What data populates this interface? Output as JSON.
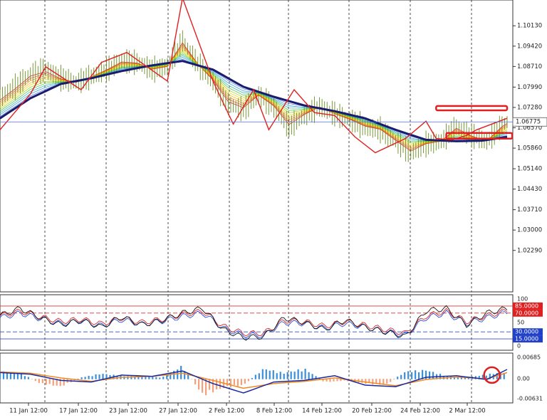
{
  "chart_data": [
    {
      "type": "line",
      "pane": "price",
      "ylim": [
        1.0129,
        1.1103
      ],
      "y_ticks": [
        "1.10130",
        "1.09420",
        "1.08710",
        "1.07990",
        "1.07280",
        "1.06570",
        "1.05860",
        "1.05140",
        "1.04430",
        "1.03710",
        "1.03000",
        "1.02290"
      ],
      "x_ticks": [
        "11 Jan 12:00",
        "17 Jan 12:00",
        "23 Jan 12:00",
        "27 Jan 12:00",
        "2 Feb 12:00",
        "8 Feb 12:00",
        "14 Feb 12:00",
        "20 Feb 12:00",
        "24 Feb 12:00",
        "2 Mar 12:00"
      ],
      "current_price": "1.06775",
      "x_index_range": [
        0,
        100
      ],
      "colors": {
        "price_bar": "#6b8e23",
        "main_ma": "#1a1a6e",
        "zigzag": "#e02020",
        "hline": "#4f6fd8",
        "grid": "#222222"
      },
      "series": [
        {
          "role": "close",
          "x": [
            0,
            3,
            6,
            9,
            12,
            15,
            18,
            21,
            24,
            27,
            30,
            33,
            36,
            39,
            42,
            45,
            48,
            51,
            54,
            57,
            60,
            63,
            66,
            69,
            72,
            75,
            78,
            81,
            84,
            87,
            90,
            93,
            96,
            99,
            100
          ],
          "values": [
            1.076,
            1.08,
            1.0845,
            1.086,
            1.083,
            1.0815,
            1.0835,
            1.086,
            1.089,
            1.0885,
            1.086,
            1.087,
            1.096,
            1.088,
            1.082,
            1.074,
            1.072,
            1.077,
            1.073,
            1.066,
            1.07,
            1.073,
            1.0705,
            1.0685,
            1.066,
            1.065,
            1.061,
            1.057,
            1.06,
            1.061,
            1.066,
            1.063,
            1.061,
            1.0665,
            1.0677
          ]
        },
        {
          "role": "main-ma",
          "x": [
            0,
            6,
            12,
            18,
            24,
            30,
            36,
            42,
            48,
            54,
            60,
            66,
            72,
            78,
            84,
            90,
            95,
            100
          ],
          "values": [
            1.069,
            1.076,
            1.081,
            1.083,
            1.0855,
            1.0875,
            1.089,
            1.086,
            1.08,
            1.0765,
            1.0735,
            1.0715,
            1.069,
            1.065,
            1.0615,
            1.061,
            1.0612,
            1.0625
          ]
        },
        {
          "role": "zigzag",
          "x": [
            0,
            6,
            9,
            16,
            20,
            25,
            29,
            33,
            36,
            42,
            46,
            50,
            53,
            58,
            62,
            66,
            70,
            74,
            80,
            84,
            86,
            89,
            92,
            94,
            100
          ],
          "values": [
            1.065,
            1.0775,
            1.087,
            1.079,
            1.0885,
            1.092,
            1.087,
            1.082,
            1.111,
            1.082,
            1.067,
            1.079,
            1.065,
            1.079,
            1.071,
            1.07,
            1.0625,
            1.057,
            1.062,
            1.068,
            1.062,
            1.0615,
            1.063,
            1.065,
            1.069
          ]
        }
      ],
      "annotations": [
        {
          "type": "rect",
          "x": [
            86,
            100
          ],
          "y": [
            1.0718,
            1.0733
          ]
        },
        {
          "type": "rect",
          "x": [
            88,
            101
          ],
          "y": [
            1.0619,
            1.0639
          ]
        }
      ]
    },
    {
      "type": "line",
      "pane": "stochastic",
      "ylim": [
        0,
        100
      ],
      "y_ticks": [
        "100",
        "85.0000",
        "70.0000",
        "50",
        "30.0000",
        "15.0000",
        "0"
      ],
      "levels": [
        85,
        70,
        30,
        15
      ],
      "colors": {
        "main": "#111111",
        "signal1": "#d62728",
        "signal2": "#2850d8",
        "level_high": "#e03030",
        "level_low": "#3050d0"
      },
      "series": [
        {
          "role": "stoch-main",
          "x": [
            0,
            4,
            8,
            12,
            16,
            20,
            24,
            28,
            32,
            36,
            40,
            44,
            48,
            52,
            56,
            60,
            64,
            68,
            72,
            76,
            80,
            84,
            88,
            92,
            96,
            100
          ],
          "values": [
            65,
            80,
            60,
            45,
            55,
            40,
            62,
            45,
            55,
            70,
            80,
            35,
            18,
            20,
            60,
            50,
            35,
            55,
            40,
            30,
            20,
            75,
            80,
            45,
            70,
            80
          ]
        },
        {
          "role": "stoch-signal",
          "x": [
            0,
            4,
            8,
            12,
            16,
            20,
            24,
            28,
            32,
            36,
            40,
            44,
            48,
            52,
            56,
            60,
            64,
            68,
            72,
            76,
            80,
            84,
            88,
            92,
            96,
            100
          ],
          "values": [
            62,
            72,
            60,
            50,
            55,
            45,
            58,
            48,
            55,
            65,
            72,
            40,
            25,
            25,
            52,
            50,
            40,
            50,
            42,
            33,
            25,
            62,
            72,
            50,
            62,
            74
          ]
        }
      ]
    },
    {
      "type": "bar",
      "pane": "macd",
      "ylim": [
        -0.006312,
        0.006858
      ],
      "y_ticks": [
        "0.00685",
        "0.00",
        "-0.00631"
      ],
      "colors": {
        "positive": "#3a8fd8",
        "negative": "#f4a07a",
        "line_main": "#1a2a9e",
        "line_signal": "#f08a24",
        "marker": "#e02020"
      },
      "series": [
        {
          "role": "histogram",
          "x": [
            0,
            4,
            8,
            12,
            16,
            20,
            24,
            28,
            32,
            36,
            40,
            44,
            48,
            52,
            56,
            60,
            64,
            68,
            72,
            76,
            80,
            84,
            88,
            92,
            96,
            100
          ],
          "values": [
            0.0025,
            0.002,
            -0.0015,
            -0.0025,
            0.0005,
            0.0018,
            0.001,
            0.0008,
            0.0005,
            0.0045,
            -0.0055,
            -0.003,
            -0.002,
            0.0035,
            0.002,
            0.0035,
            -0.001,
            -0.0005,
            -0.0015,
            -0.002,
            0.0025,
            0.003,
            0.001,
            0.0005,
            0.0015,
            0.0025
          ]
        },
        {
          "role": "macd-line",
          "x": [
            0,
            6,
            12,
            18,
            24,
            30,
            36,
            42,
            48,
            54,
            60,
            66,
            72,
            78,
            84,
            90,
            96,
            100
          ],
          "values": [
            0.002,
            0.0015,
            -0.0005,
            -0.001,
            0.0012,
            0.0008,
            0.0025,
            -0.0015,
            -0.0045,
            -0.001,
            -0.0005,
            0.001,
            -0.002,
            -0.0025,
            0.0005,
            0.001,
            -0.0002,
            0.003
          ]
        },
        {
          "role": "macd-signal",
          "x": [
            0,
            6,
            12,
            18,
            24,
            30,
            36,
            42,
            48,
            54,
            60,
            66,
            72,
            78,
            84,
            90,
            96,
            100
          ],
          "values": [
            0.0022,
            0.0018,
            0.0003,
            -0.0008,
            0.0005,
            0.0008,
            0.0018,
            -0.0005,
            -0.003,
            -0.0015,
            -0.0008,
            0.0003,
            -0.001,
            -0.0022,
            -0.0002,
            0.0006,
            0.0,
            0.002
          ]
        }
      ],
      "annotations": [
        {
          "type": "circle-marker",
          "x": 97,
          "y": 0.0012
        }
      ]
    }
  ]
}
